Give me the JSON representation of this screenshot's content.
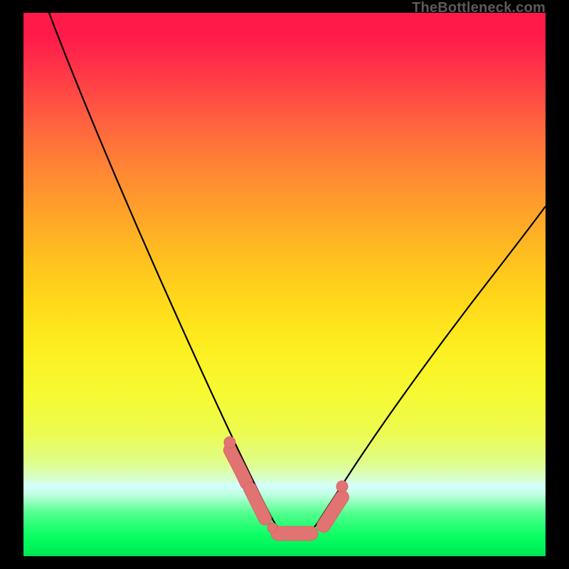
{
  "domain": "Chart",
  "watermark": "TheBottleneck.com",
  "colors": {
    "frame": "#000000",
    "curve_stroke": "#000000",
    "marker_fill": "#e27373",
    "marker_stroke": "#da6464",
    "watermark": "#5b5b5b"
  },
  "chart_data": {
    "type": "line",
    "title": "",
    "xlabel": "",
    "ylabel": "",
    "xlim": [
      0,
      100
    ],
    "ylim": [
      0,
      100
    ],
    "grid": false,
    "legend": false,
    "series": [
      {
        "name": "bottleneck-curve",
        "x": [
          5,
          8,
          12,
          16,
          20,
          24,
          28,
          32,
          34,
          36,
          38,
          40,
          42,
          44,
          45,
          46,
          48,
          50,
          52,
          54,
          56,
          58,
          60,
          64,
          68,
          72,
          76,
          80,
          85,
          90,
          95,
          100
        ],
        "y": [
          100,
          94,
          86,
          78,
          70,
          62,
          54,
          45,
          40,
          35,
          30,
          24,
          19,
          13,
          10,
          8,
          5,
          4.5,
          4.5,
          5,
          6,
          8,
          10,
          14,
          18,
          23,
          28,
          34,
          41,
          48,
          55,
          62
        ]
      }
    ],
    "highlight_segments": [
      {
        "name": "left-segment",
        "x_range": [
          40,
          46
        ],
        "y_range": [
          6,
          24
        ]
      },
      {
        "name": "bottom-flat",
        "x_range": [
          46,
          55
        ],
        "y_range": [
          4.5,
          6
        ]
      },
      {
        "name": "right-segment",
        "x_range": [
          55,
          60
        ],
        "y_range": [
          6,
          10
        ]
      }
    ],
    "notes": "V-shaped bottleneck curve over vertical rainbow gradient. Minimum ≈4.5 around x≈50. Pink sausage-shaped markers trace three short segments near the bottom of the V."
  }
}
